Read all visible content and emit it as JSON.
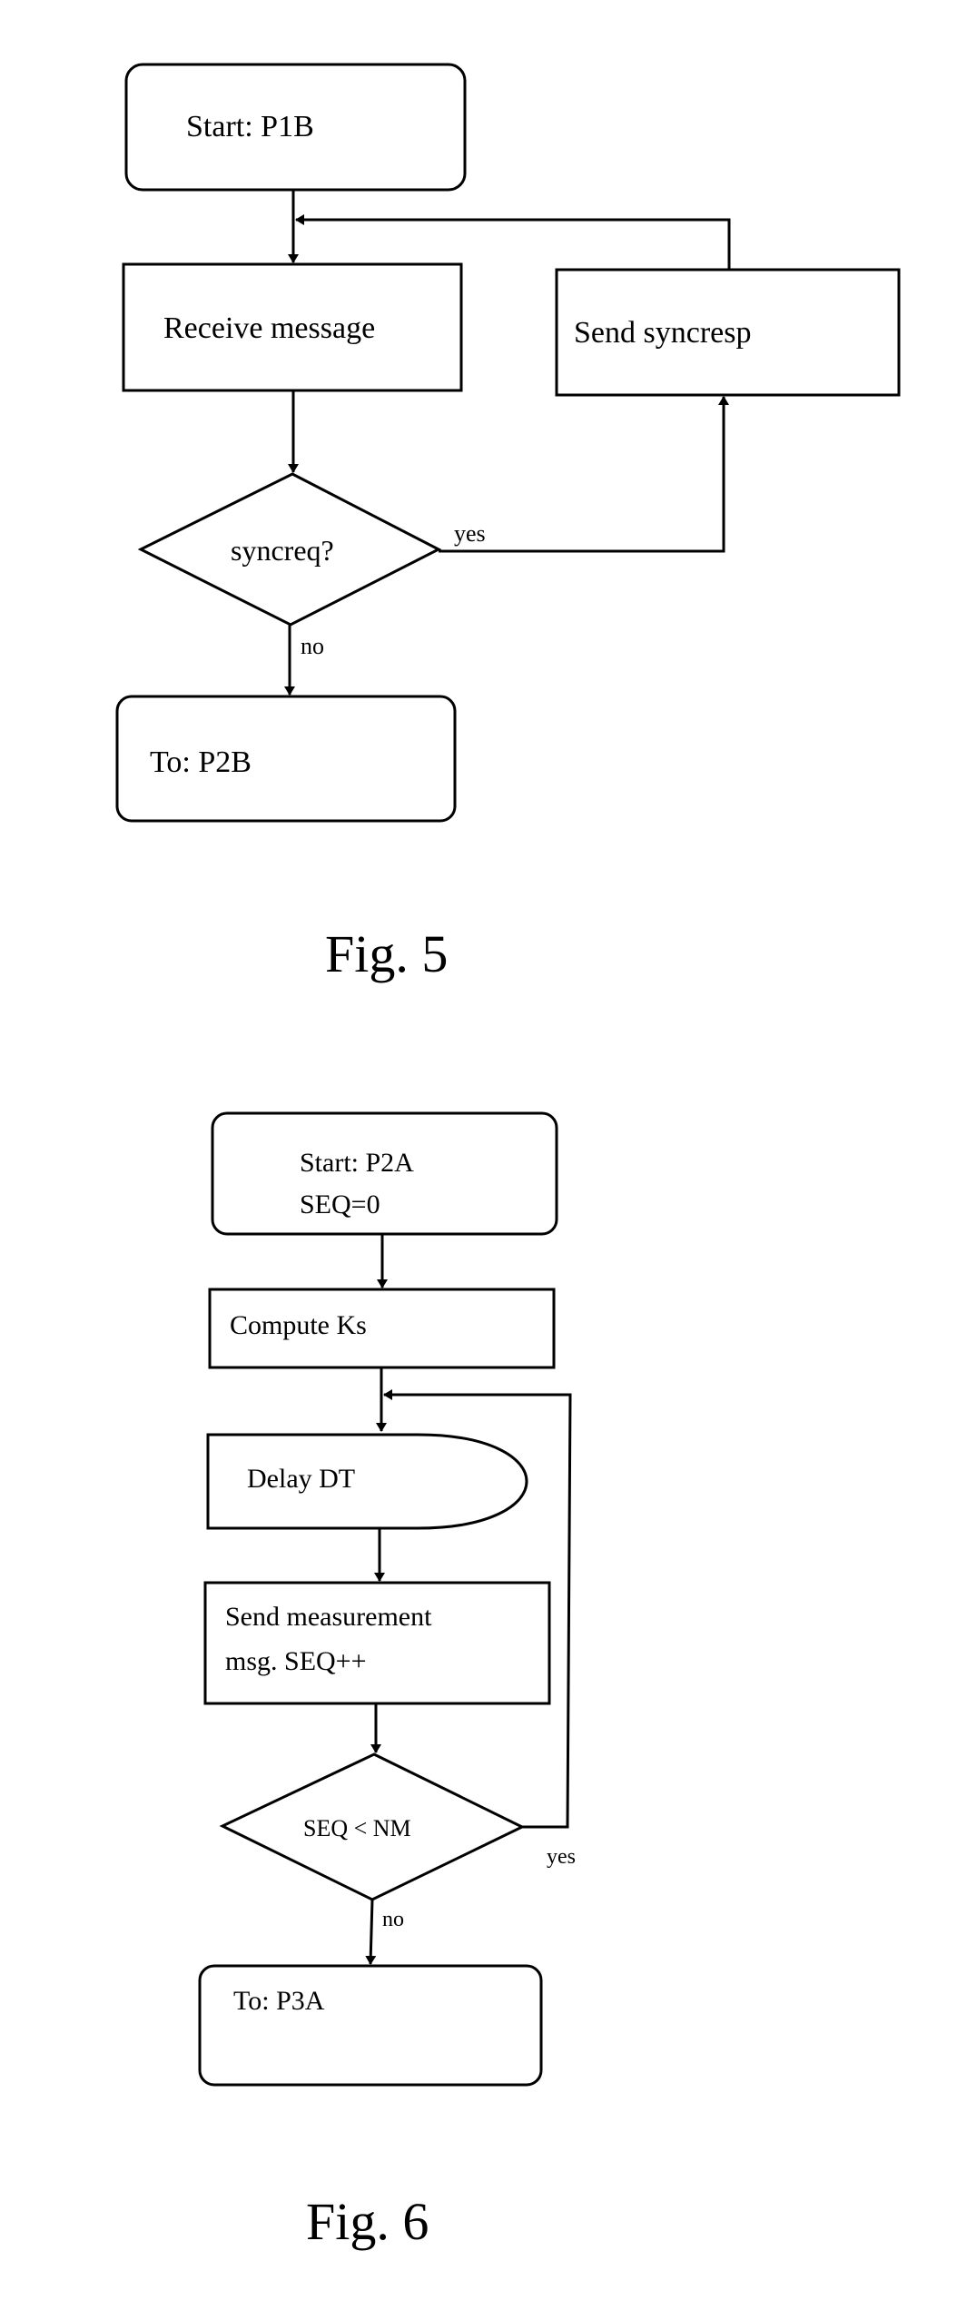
{
  "figures": [
    {
      "caption": "Fig. 5",
      "nodes": {
        "start": "Start:  P1B",
        "receive": "Receive message",
        "send_syncresp": "Send syncresp",
        "decision": "syncreq?",
        "end": "To: P2B"
      },
      "edge_labels": {
        "yes": "yes",
        "no": "no"
      }
    },
    {
      "caption": "Fig. 6",
      "nodes": {
        "start_line1": "Start: P2A",
        "start_line2": "SEQ=0",
        "compute": "Compute Ks",
        "delay": "Delay DT",
        "send_line1": "Send measurement",
        "send_line2": "msg. SEQ++",
        "decision": "SEQ < NM",
        "end": "To: P3A"
      },
      "edge_labels": {
        "yes": "yes",
        "no": "no"
      }
    }
  ]
}
